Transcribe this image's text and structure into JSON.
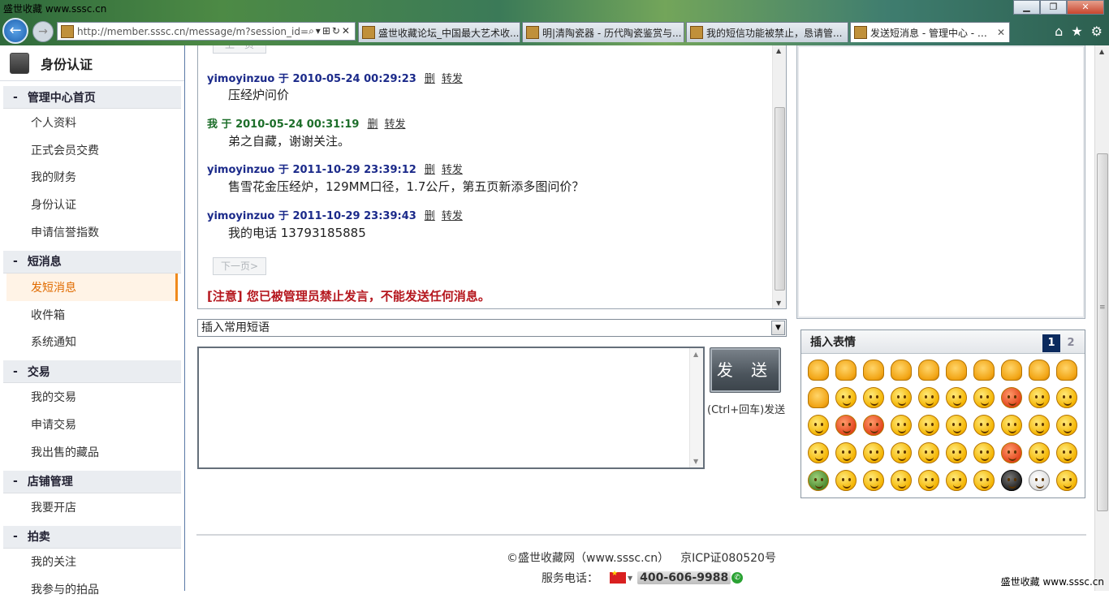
{
  "watermark": "盛世收藏  www.sssc.cn",
  "browser": {
    "address": "http://member.sssc.cn/message/m?session_id=",
    "tabs": [
      {
        "title": "盛世收藏论坛_中国最大艺术收...",
        "active": false
      },
      {
        "title": "明|清陶瓷器 - 历代陶瓷鉴赏与...",
        "active": false
      },
      {
        "title": "我的短信功能被禁止，恳请管...",
        "active": false
      },
      {
        "title": "发送短消息 - 管理中心 - 盛...",
        "active": true
      }
    ]
  },
  "sidebar": {
    "title": "身份认证",
    "sections": [
      {
        "label": "管理中心首页",
        "items": [
          "个人资料",
          "正式会员交费",
          "我的财务",
          "身份认证",
          "申请信誉指数"
        ]
      },
      {
        "label": "短消息",
        "items": [
          "发短消息",
          "收件箱",
          "系统通知"
        ]
      },
      {
        "label": "交易",
        "items": [
          "我的交易",
          "申请交易",
          "我出售的藏品"
        ]
      },
      {
        "label": "店铺管理",
        "items": [
          "我要开店"
        ]
      },
      {
        "label": "拍卖",
        "items": [
          "我的关注",
          "我参与的拍品"
        ]
      }
    ],
    "active_item": "发短消息"
  },
  "messages": [
    {
      "author": "yimoyinzuo",
      "sep": "于",
      "time": "2010-05-24 00:29:23",
      "body": "压经炉问价",
      "me": false
    },
    {
      "author": "我",
      "sep": "于",
      "time": "2010-05-24 00:31:19",
      "body": "弟之自藏，谢谢关注。",
      "me": true
    },
    {
      "author": "yimoyinzuo",
      "sep": "于",
      "time": "2011-10-29 23:39:12",
      "body": "售雪花金压经炉，129MM口径，1.7公斤，第五页新添多图问价？",
      "me": false
    },
    {
      "author": "yimoyinzuo",
      "sep": "于",
      "time": "2011-10-29 23:39:43",
      "body": "我的电话 13793185885",
      "me": false
    }
  ],
  "message_actions": {
    "delete": "删",
    "forward": "转发"
  },
  "prev_page": "上一页",
  "next_page": "下一页>",
  "notice": "[注意] 您已被管理员禁止发言，不能发送任何消息。",
  "phrase_select": "插入常用短语",
  "send_button": "发 送",
  "send_hint": "(Ctrl+回车)发送",
  "emoticons": {
    "title": "插入表情",
    "page_current": "1",
    "page_other": "2"
  },
  "footer": {
    "copyright": "©盛世收藏网（www.sssc.cn）",
    "icp": "京ICP证080520号",
    "service_label": "服务电话：",
    "phone": "400-606-9988"
  },
  "watermark_bottom": "盛世收藏  www.sssc.cn"
}
